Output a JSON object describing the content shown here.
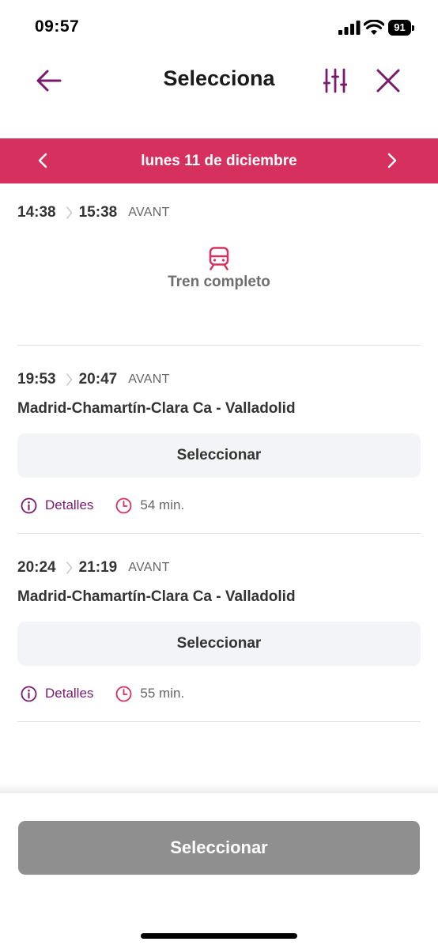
{
  "status_bar": {
    "time": "09:57",
    "battery": "91"
  },
  "header": {
    "title": "Selecciona",
    "back_icon": "arrow-left-icon",
    "filter_icon": "sliders-icon",
    "close_icon": "close-icon"
  },
  "date_bar": {
    "label": "lunes 11 de diciembre"
  },
  "trips": [
    {
      "depart": "14:38",
      "arrive": "15:38",
      "brand": "AVANT",
      "status": "Tren completo"
    },
    {
      "depart": "19:53",
      "arrive": "20:47",
      "brand": "AVANT",
      "route": "Madrid-Chamartín-Clara Ca - Valladolid",
      "select_label": "Seleccionar",
      "details_label": "Detalles",
      "duration": "54 min."
    },
    {
      "depart": "20:24",
      "arrive": "21:19",
      "brand": "AVANT",
      "route": "Madrid-Chamartín-Clara Ca - Valladolid",
      "select_label": "Seleccionar",
      "details_label": "Detalles",
      "duration": "55 min."
    }
  ],
  "footer": {
    "select_label": "Seleccionar"
  },
  "colors": {
    "accent": "#d6305f",
    "icon_purple": "#7a1a6e",
    "disabled_button": "#8f8f8f",
    "secondary_button": "#f3f4f8"
  }
}
